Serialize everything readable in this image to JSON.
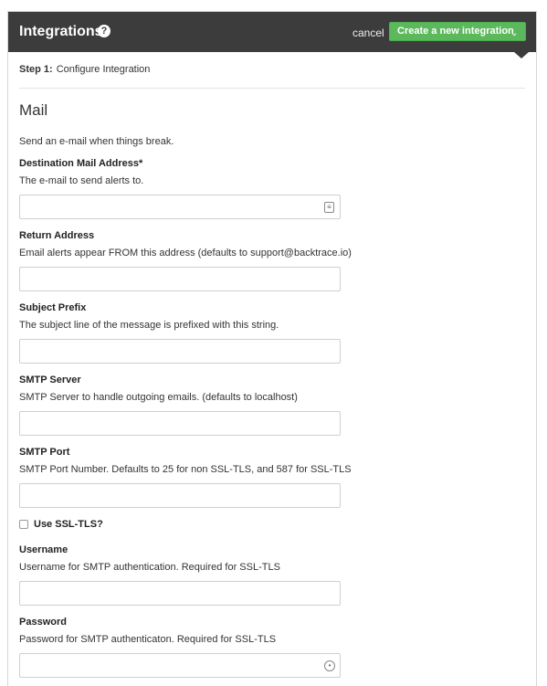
{
  "header": {
    "title": "Integrations",
    "help_icon": "?",
    "cancel_label": "cancel",
    "create_label": "Create a new integration",
    "create_caret": "⌄"
  },
  "step": {
    "number": "Step 1:",
    "label": "Configure Integration"
  },
  "section": {
    "title": "Mail",
    "description": "Send an e-mail when things break."
  },
  "fields": [
    {
      "label": "Destination Mail Address*",
      "description": "The e-mail to send alerts to.",
      "value": "",
      "icon": "contact-card-icon"
    },
    {
      "label": "Return Address",
      "description": "Email alerts appear FROM this address (defaults to support@backtrace.io)",
      "value": ""
    },
    {
      "label": "Subject Prefix",
      "description": "The subject line of the message is prefixed with this string.",
      "value": ""
    },
    {
      "label": "SMTP Server",
      "description": "SMTP Server to handle outgoing emails. (defaults to localhost)",
      "value": ""
    },
    {
      "label": "SMTP Port",
      "description": "SMTP Port Number. Defaults to 25 for non SSL-TLS, and 587 for SSL-TLS",
      "value": ""
    },
    {
      "label": "Username",
      "description": "Username for SMTP authentication. Required for SSL-TLS",
      "value": ""
    },
    {
      "label": "Password",
      "description": "Password for SMTP authenticaton. Required for SSL-TLS",
      "value": "",
      "icon": "password-manager-icon"
    }
  ],
  "ssl": {
    "label": "Use SSL-TLS?",
    "checked": false
  },
  "colors": {
    "header_bg": "#3c3c3c",
    "accent_green": "#5cb85c"
  }
}
